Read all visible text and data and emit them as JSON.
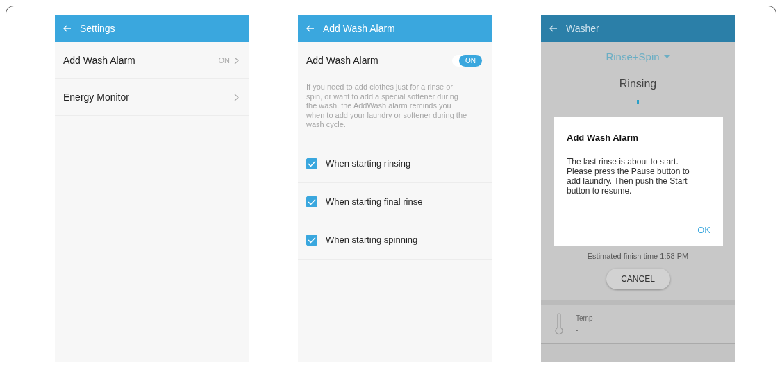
{
  "settings_screen": {
    "title": "Settings",
    "items": [
      {
        "label": "Add Wash Alarm",
        "value": "ON"
      },
      {
        "label": "Energy Monitor"
      }
    ]
  },
  "alarm_screen": {
    "title": "Add Wash Alarm",
    "toggle": {
      "label": "Add Wash Alarm",
      "on": true,
      "text": "ON"
    },
    "description": "If you need to add clothes just for a rinse or spin, or want to add a special softener during the wash, the AddWash alarm reminds you when to add your laundry or softener during the wash cycle.",
    "options": [
      {
        "label": "When starting rinsing",
        "checked": true
      },
      {
        "label": "When starting final rinse",
        "checked": true
      },
      {
        "label": "When starting spinning",
        "checked": true
      }
    ]
  },
  "washer_screen": {
    "title": "Washer",
    "course": "Rinse+Spin",
    "status": "Rinsing",
    "finish_time": "Estimated finish time 1:58 PM",
    "cancel": "CANCEL",
    "temp_label": "Temp",
    "temp_value": "-",
    "dialog": {
      "title": "Add Wash Alarm",
      "message": "The last rinse is about to start. Please press the Pause button to add laundry. Then push the Start button to resume.",
      "ok": "OK"
    }
  }
}
